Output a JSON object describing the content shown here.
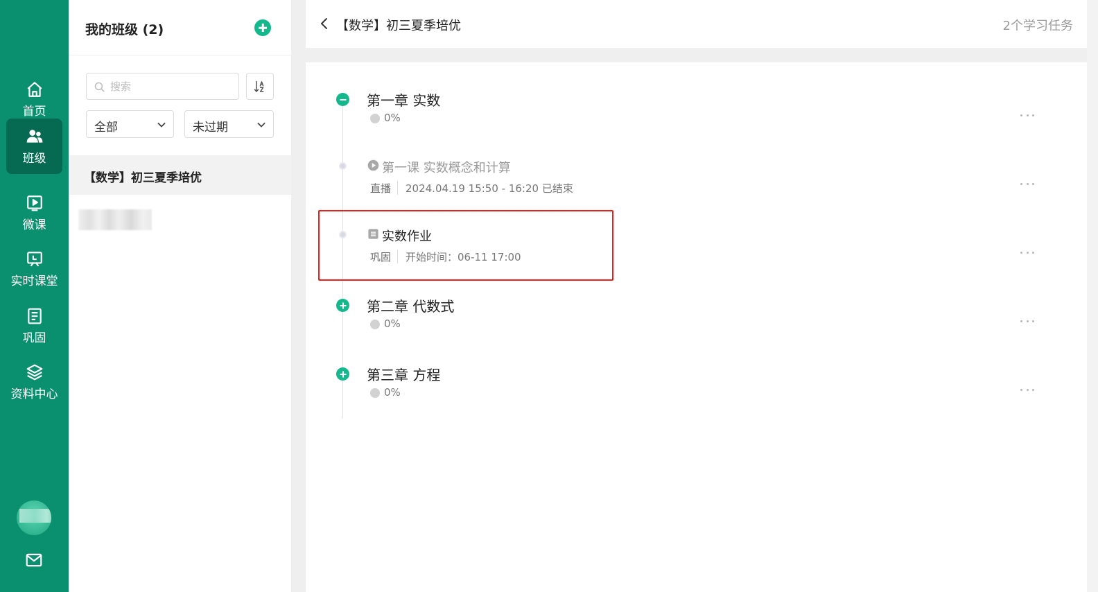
{
  "nav": {
    "items": [
      {
        "label": "首页",
        "icon": "home-icon"
      },
      {
        "label": "班级",
        "icon": "class-users-icon",
        "active": true
      },
      {
        "label": "微课",
        "icon": "micro-lesson-icon"
      },
      {
        "label": "实时课堂",
        "icon": "live-classroom-icon"
      },
      {
        "label": "巩固",
        "icon": "practice-icon"
      },
      {
        "label": "资料中心",
        "icon": "resource-layers-icon"
      }
    ],
    "mail_icon": "mail-icon"
  },
  "class_panel": {
    "title": "我的班级 (2)",
    "search_placeholder": "搜索",
    "filter_type": "全部",
    "filter_status": "未过期",
    "classes": [
      {
        "name": "【数学】初三夏季培优",
        "selected": true
      }
    ]
  },
  "main": {
    "title": "【数学】初三夏季培优",
    "task_count": "2个学习任务",
    "nodes": [
      {
        "kind": "chapter",
        "title": "第一章 实数",
        "progress": "0%",
        "expanded": true
      },
      {
        "kind": "lesson",
        "title": "第一课 实数概念和计算",
        "tag": "直播",
        "meta": "2024.04.19 15:50 - 16:20 已结束"
      },
      {
        "kind": "homework",
        "title": "实数作业",
        "tag": "巩固",
        "meta": "开始时间：06-11 17:00"
      },
      {
        "kind": "chapter",
        "title": "第二章 代数式",
        "progress": "0%",
        "expanded": false
      },
      {
        "kind": "chapter",
        "title": "第三章 方程",
        "progress": "0%",
        "expanded": false
      }
    ]
  },
  "colors": {
    "brand": "#0a8f6f",
    "brand_active": "#066a52",
    "accent": "#15b88d",
    "highlight": "#e8211c"
  }
}
